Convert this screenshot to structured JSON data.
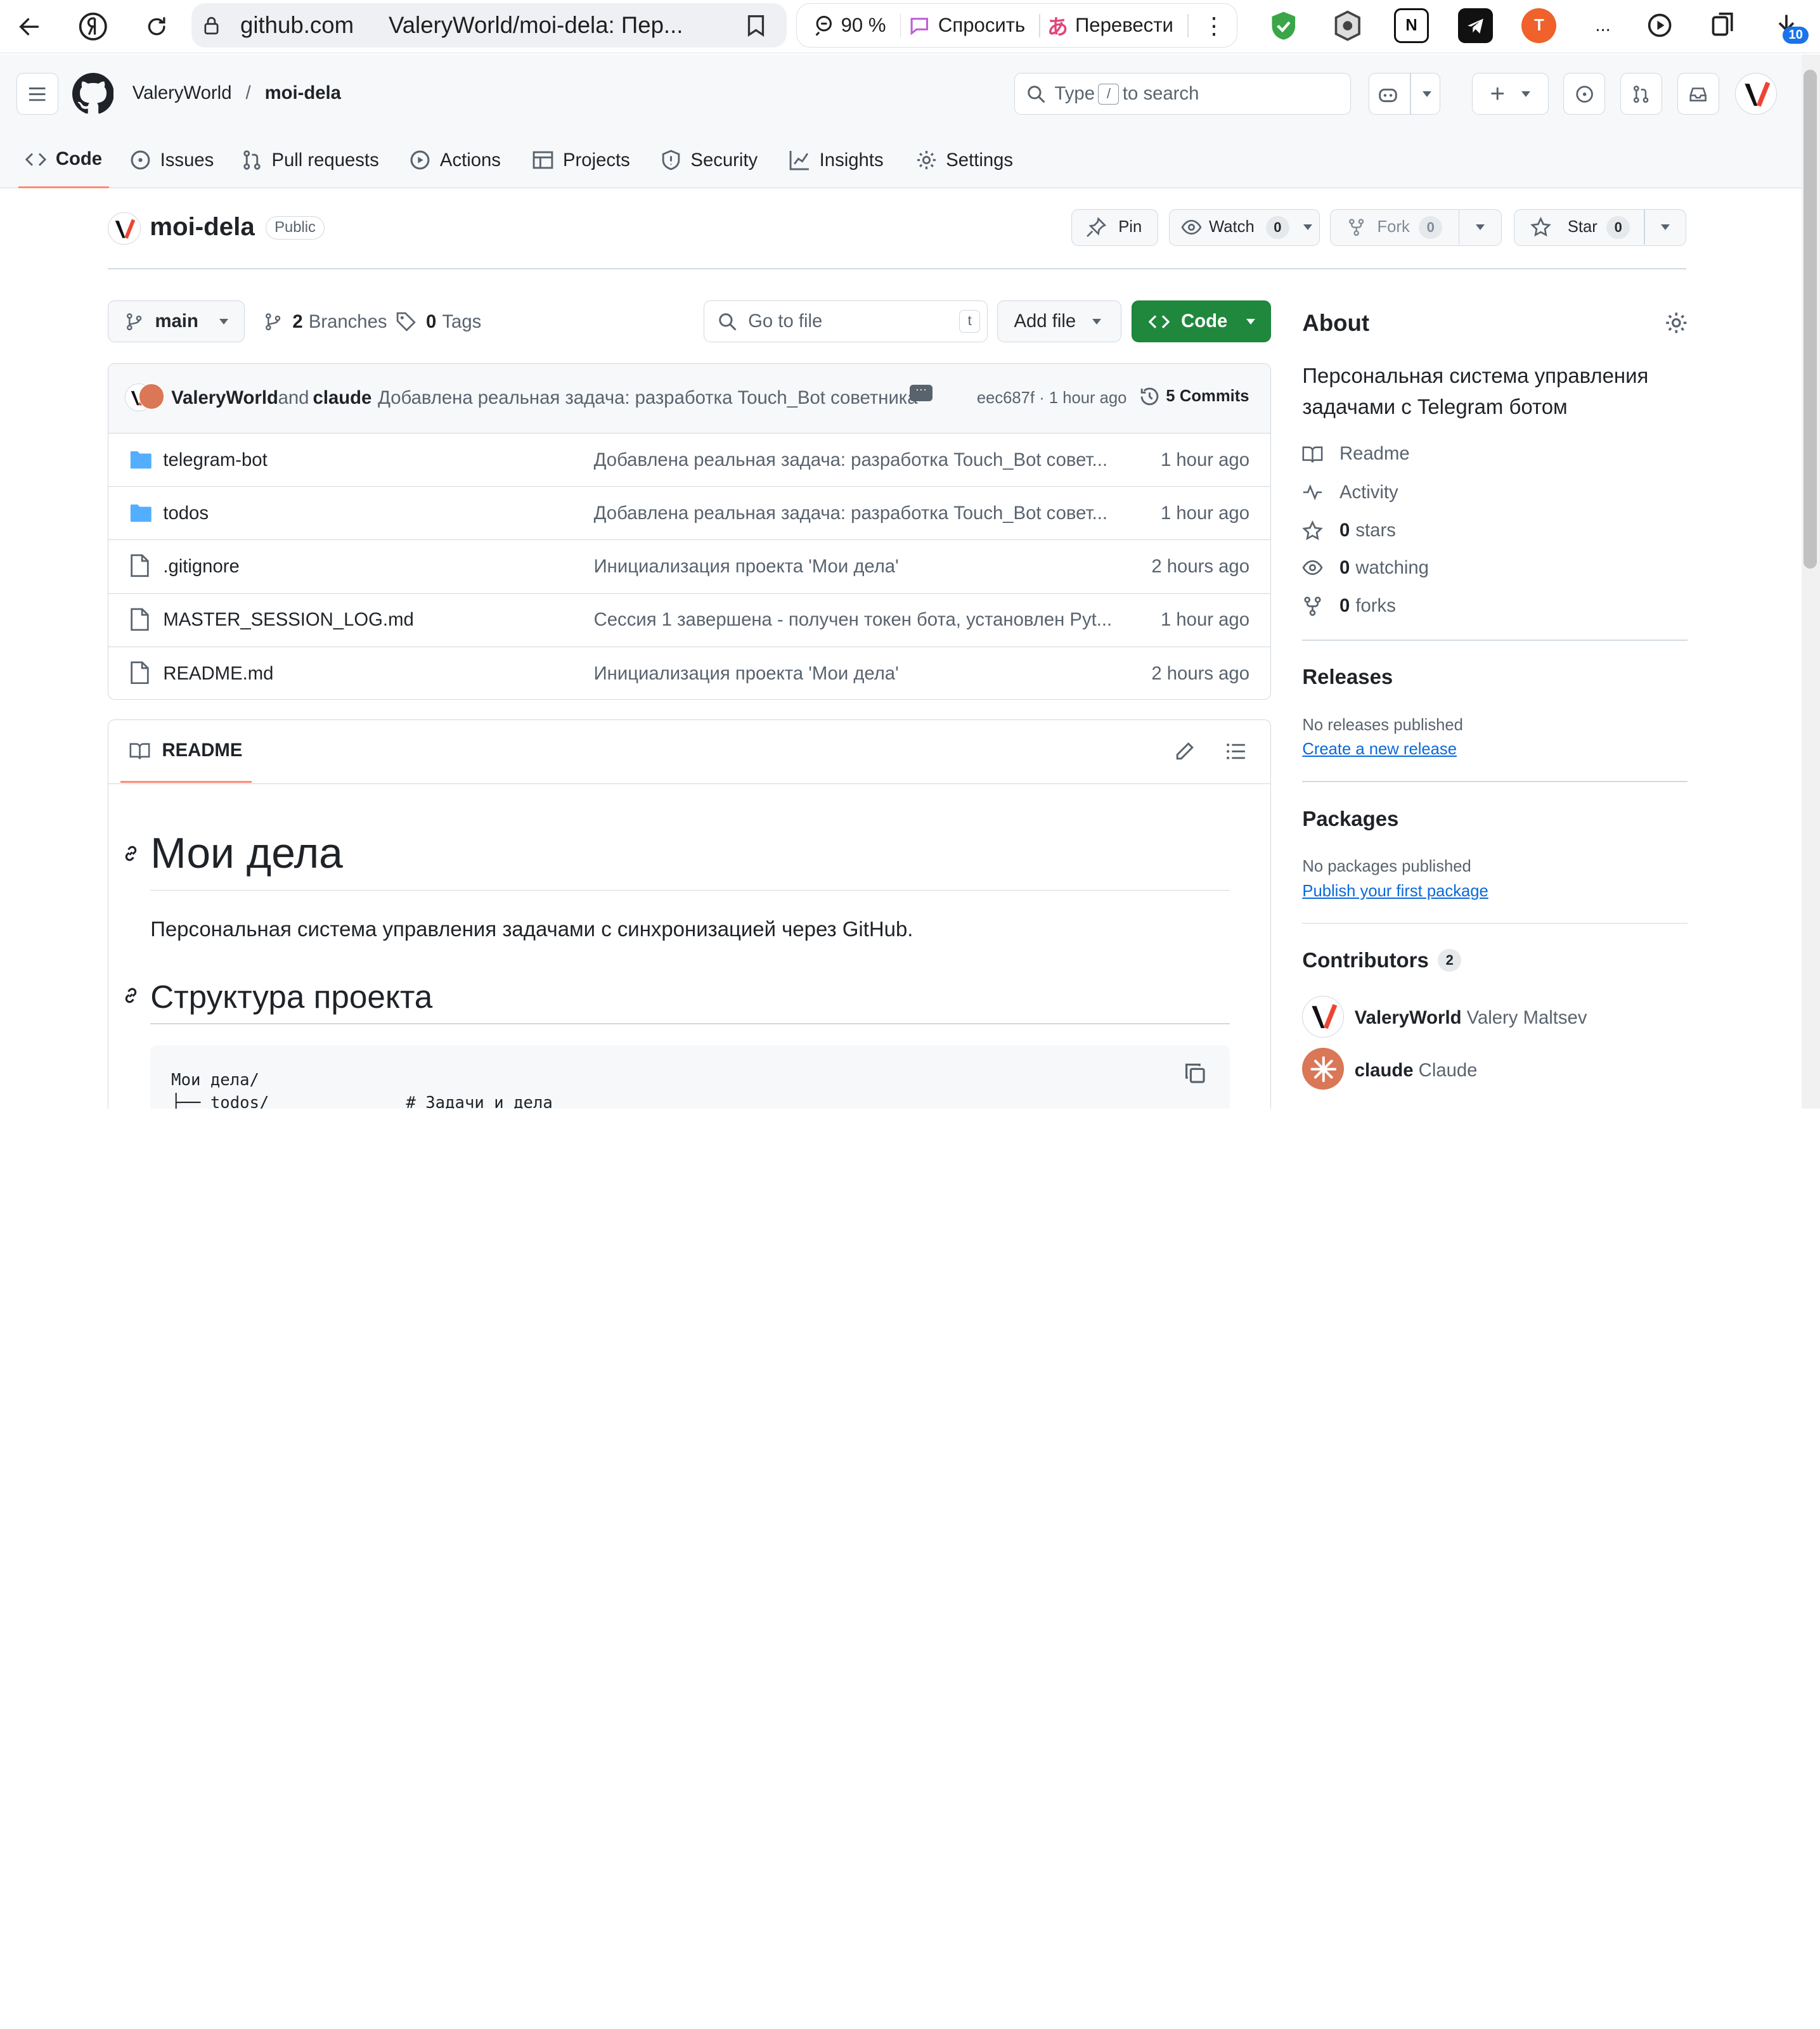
{
  "browser": {
    "url_host": "github.com",
    "tab_title": "ValeryWorld/moi-dela: Пер...",
    "zoom": "90 %",
    "ask_label": "Спросить",
    "translate_label": "Перевести",
    "downloads_badge": "10",
    "more_label": "..."
  },
  "gh": {
    "owner": "ValeryWorld",
    "separator": "/",
    "repo": "moi-dela",
    "search_pre": "Type",
    "search_key": "/",
    "search_post": "to search",
    "tabs": [
      {
        "label": "Code"
      },
      {
        "label": "Issues"
      },
      {
        "label": "Pull requests"
      },
      {
        "label": "Actions"
      },
      {
        "label": "Projects"
      },
      {
        "label": "Security"
      },
      {
        "label": "Insights"
      },
      {
        "label": "Settings"
      }
    ]
  },
  "repo": {
    "name": "moi-dela",
    "visibility": "Public",
    "pin_label": "Pin",
    "watch_label": "Watch",
    "watch_count": "0",
    "fork_label": "Fork",
    "fork_count": "0",
    "star_label": "Star",
    "star_count": "0",
    "branch": "main",
    "branches_count": "2",
    "branches_label": "Branches",
    "tags_count": "0",
    "tags_label": "Tags",
    "goto_placeholder": "Go to file",
    "goto_key": "t",
    "add_file_label": "Add file",
    "code_label": "Code"
  },
  "commit": {
    "author1": "ValeryWorld",
    "and": "and",
    "author2": "claude",
    "message": "Добавлена реальная задача: разработка Touch_Bot советника",
    "hash": "eec687f",
    "dot": "·",
    "time": "1 hour ago",
    "commits_count": "5",
    "commits_label": "Commits"
  },
  "files": [
    {
      "name": "telegram-bot",
      "type": "folder",
      "message": "Добавлена реальная задача: разработка Touch_Bot совет...",
      "time": "1 hour ago"
    },
    {
      "name": "todos",
      "type": "folder",
      "message": "Добавлена реальная задача: разработка Touch_Bot совет...",
      "time": "1 hour ago"
    },
    {
      "name": ".gitignore",
      "type": "file",
      "message": "Инициализация проекта 'Мои дела'",
      "time": "2 hours ago"
    },
    {
      "name": "MASTER_SESSION_LOG.md",
      "type": "file",
      "message": "Сессия 1 завершена - получен токен бота, установлен Pyt...",
      "time": "1 hour ago"
    },
    {
      "name": "README.md",
      "type": "file",
      "message": "Инициализация проекта 'Мои дела'",
      "time": "2 hours ago"
    }
  ],
  "readme": {
    "tab_label": "README",
    "h1": "Мои дела",
    "intro": "Персональная система управления задачами с синхронизацией через GitHub.",
    "h2": "Структура проекта",
    "code_line1": "Мои дела/",
    "code_line2": "├── todos/              # Задачи и дела"
  },
  "about": {
    "title": "About",
    "description": "Персональная система управления задачами с Telegram ботом",
    "readme_label": "Readme",
    "activity_label": "Activity",
    "stars_count": "0",
    "stars_label": "stars",
    "watching_count": "0",
    "watching_label": "watching",
    "forks_count": "0",
    "forks_label": "forks"
  },
  "releases": {
    "title": "Releases",
    "empty": "No releases published",
    "link": "Create a new release"
  },
  "packages": {
    "title": "Packages",
    "empty": "No packages published",
    "link": "Publish your first package"
  },
  "contributors": {
    "title": "Contributors",
    "count": "2",
    "people": [
      {
        "login": "ValeryWorld",
        "name": "Valery Maltsev"
      },
      {
        "login": "claude",
        "name": "Claude"
      }
    ]
  },
  "colors": {
    "accent_green": "#1f883d",
    "link_blue": "#0969da",
    "tab_underline": "#fd8c73",
    "folder_blue": "#54aeff"
  }
}
